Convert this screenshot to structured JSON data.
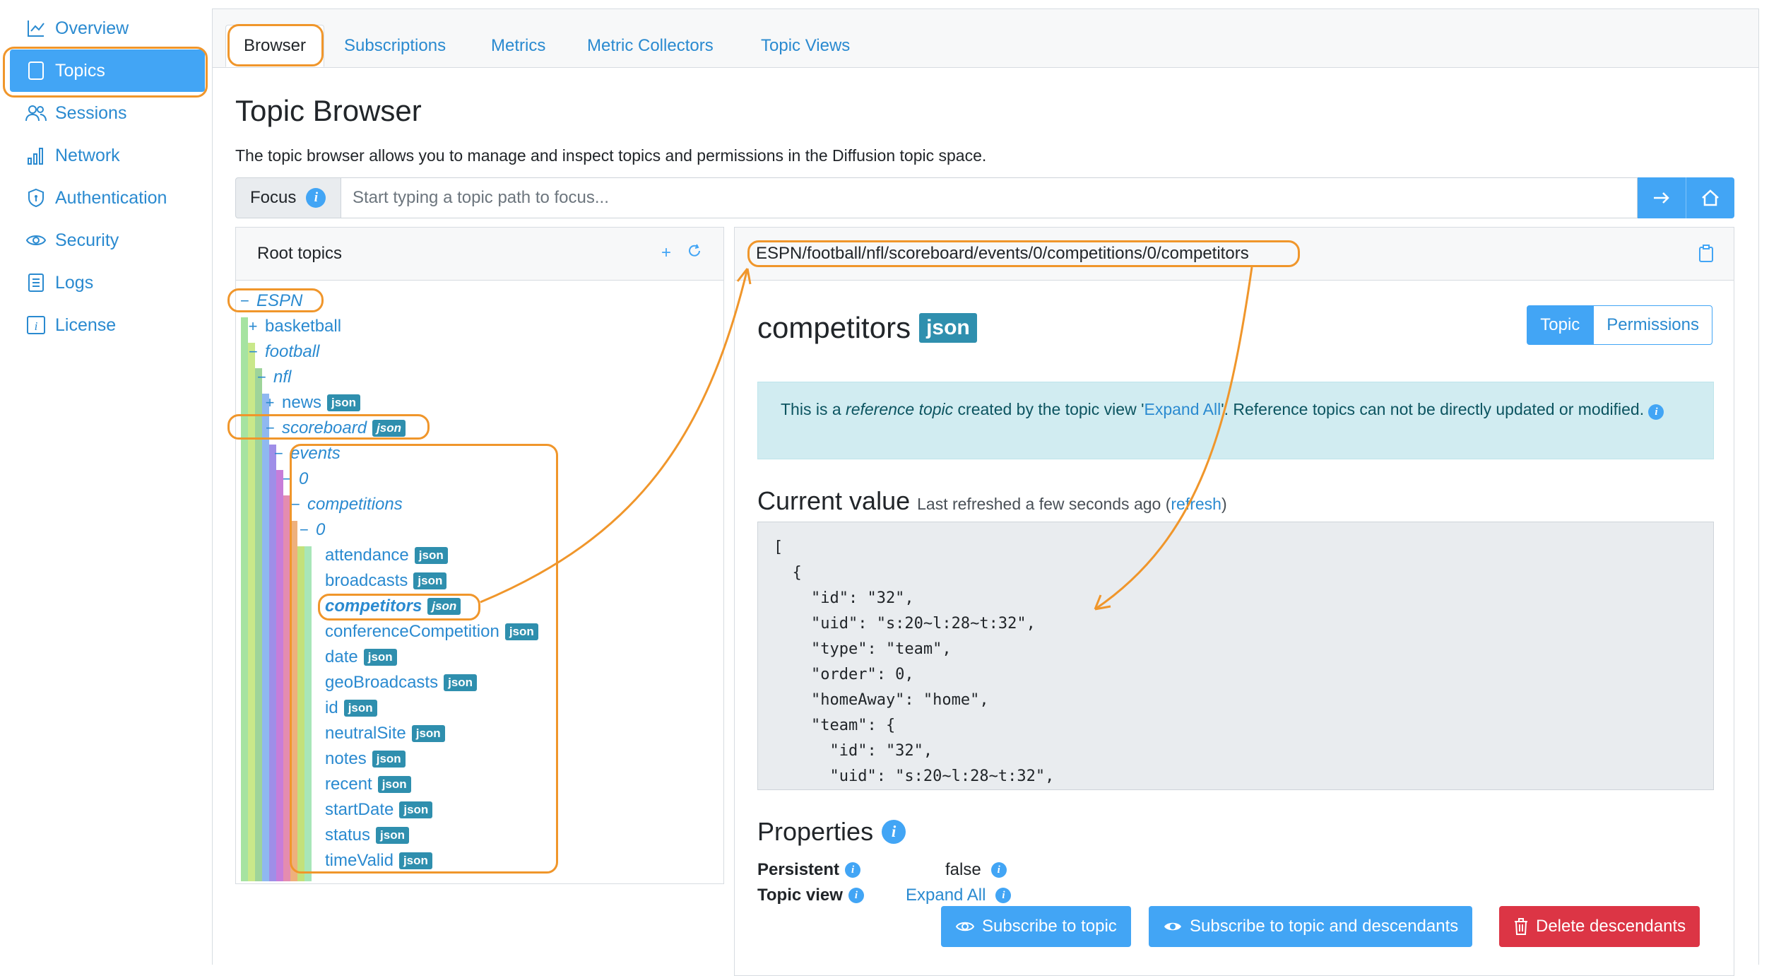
{
  "sidebar": {
    "items": [
      {
        "label": "Overview",
        "icon": "chart-line-icon",
        "active": false
      },
      {
        "label": "Topics",
        "icon": "document-icon",
        "active": true
      },
      {
        "label": "Sessions",
        "icon": "users-icon",
        "active": false
      },
      {
        "label": "Network",
        "icon": "bar-chart-icon",
        "active": false
      },
      {
        "label": "Authentication",
        "icon": "shield-icon",
        "active": false
      },
      {
        "label": "Security",
        "icon": "eye-icon",
        "active": false
      },
      {
        "label": "Logs",
        "icon": "log-icon",
        "active": false
      },
      {
        "label": "License",
        "icon": "info-square-icon",
        "active": false
      }
    ]
  },
  "tabs": [
    {
      "label": "Browser",
      "active": true
    },
    {
      "label": "Subscriptions",
      "active": false
    },
    {
      "label": "Metrics",
      "active": false
    },
    {
      "label": "Metric Collectors",
      "active": false
    },
    {
      "label": "Topic Views",
      "active": false
    }
  ],
  "page": {
    "title": "Topic Browser",
    "description": "The topic browser allows you to manage and inspect topics and permissions in the Diffusion topic space."
  },
  "focus": {
    "label": "Focus",
    "placeholder": "Start typing a topic path to focus..."
  },
  "tree": {
    "header": "Root topics",
    "badge": "json",
    "nodes": [
      {
        "label": "ESPN",
        "toggle": "−",
        "italic": true
      },
      {
        "label": "basketball",
        "toggle": "+"
      },
      {
        "label": "football",
        "toggle": "−",
        "italic": true
      },
      {
        "label": "nfl",
        "toggle": "−",
        "italic": true
      },
      {
        "label": "news",
        "toggle": "+"
      },
      {
        "label": "scoreboard",
        "toggle": "−",
        "italic": true
      },
      {
        "label": "events",
        "toggle": "−",
        "italic": true
      },
      {
        "label": "0",
        "toggle": "−",
        "italic": true
      },
      {
        "label": "competitions",
        "toggle": "−",
        "italic": true
      },
      {
        "label": "0",
        "toggle": "−",
        "italic": true
      },
      {
        "label": "attendance"
      },
      {
        "label": "broadcasts"
      },
      {
        "label": "competitors"
      },
      {
        "label": "conferenceCompetition"
      },
      {
        "label": "date"
      },
      {
        "label": "geoBroadcasts"
      },
      {
        "label": "id"
      },
      {
        "label": "neutralSite"
      },
      {
        "label": "notes"
      },
      {
        "label": "recent"
      },
      {
        "label": "startDate"
      },
      {
        "label": "status"
      },
      {
        "label": "timeValid"
      }
    ]
  },
  "detail": {
    "path": "ESPN/football/nfl/scoreboard/events/0/competitions/0/competitors",
    "name": "competitors",
    "type_badge": "json",
    "seg_topic": "Topic",
    "seg_permissions": "Permissions",
    "alert": {
      "p1": "This is a ",
      "em": "reference topic",
      "p2": " created by the topic view '",
      "link": "Expand All",
      "p3": "'. Reference topics can not be directly updated or modified."
    },
    "current_value_title": "Current value",
    "refreshed_prefix": "Last refreshed a few seconds ago (",
    "refresh_link": "refresh",
    "refreshed_suffix": ")",
    "value_text": "[\n  {\n    \"id\": \"32\",\n    \"uid\": \"s:20~l:28~t:32\",\n    \"type\": \"team\",\n    \"order\": 0,\n    \"homeAway\": \"home\",\n    \"team\": {\n      \"id\": \"32\",\n      \"uid\": \"s:20~l:28~t:32\","
  },
  "properties": {
    "title": "Properties",
    "persistent_label": "Persistent",
    "persistent_value": "false",
    "topic_view_label": "Topic view",
    "topic_view_value": "Expand All"
  },
  "buttons": {
    "subscribe": "Subscribe to topic",
    "subscribe_desc": "Subscribe to topic and descendants",
    "delete_desc": "Delete descendants"
  },
  "colors": {
    "accent": "#42a5f5",
    "link": "#2a8ad0",
    "highlight": "#f0962b",
    "danger": "#dc3545",
    "badge": "#2f8fae"
  }
}
